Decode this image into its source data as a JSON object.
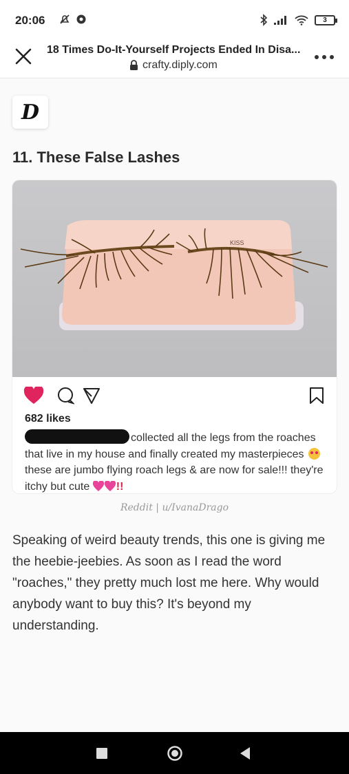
{
  "status_bar": {
    "time": "20:06",
    "battery_level": "3"
  },
  "browser": {
    "page_title": "18 Times Do-It-Yourself Projects Ended In Disa...",
    "url": "crafty.diply.com"
  },
  "site": {
    "logo_letter": "D"
  },
  "article": {
    "section_heading": "11. These False Lashes",
    "instagram_post": {
      "photo_label": "KISS",
      "likes": "682 likes",
      "caption_part1": "collected all the legs from the roaches that live in my house and finally created my masterpieces",
      "caption_part2": "these are jumbo flying roach legs & are now for sale!!! they're itchy but cute",
      "caption_end": "!!"
    },
    "credit": "Reddit | u/IvanaDrago",
    "body_text": "Speaking of weird beauty trends, this one is giving me the heebie-jeebies. As soon as I read the word \"roaches,\" they pretty much lost me here. Why would anybody want to buy this? It's beyond my understanding."
  },
  "colors": {
    "heart": "#e0245e",
    "nav_bar": "#000000",
    "lash_tray": "#f2c7b8"
  },
  "icons": {
    "close": "close-icon",
    "lock": "lock-icon",
    "menu": "more-dots-icon",
    "like": "heart-icon",
    "comment": "comment-icon",
    "share": "send-icon",
    "save": "bookmark-icon"
  }
}
